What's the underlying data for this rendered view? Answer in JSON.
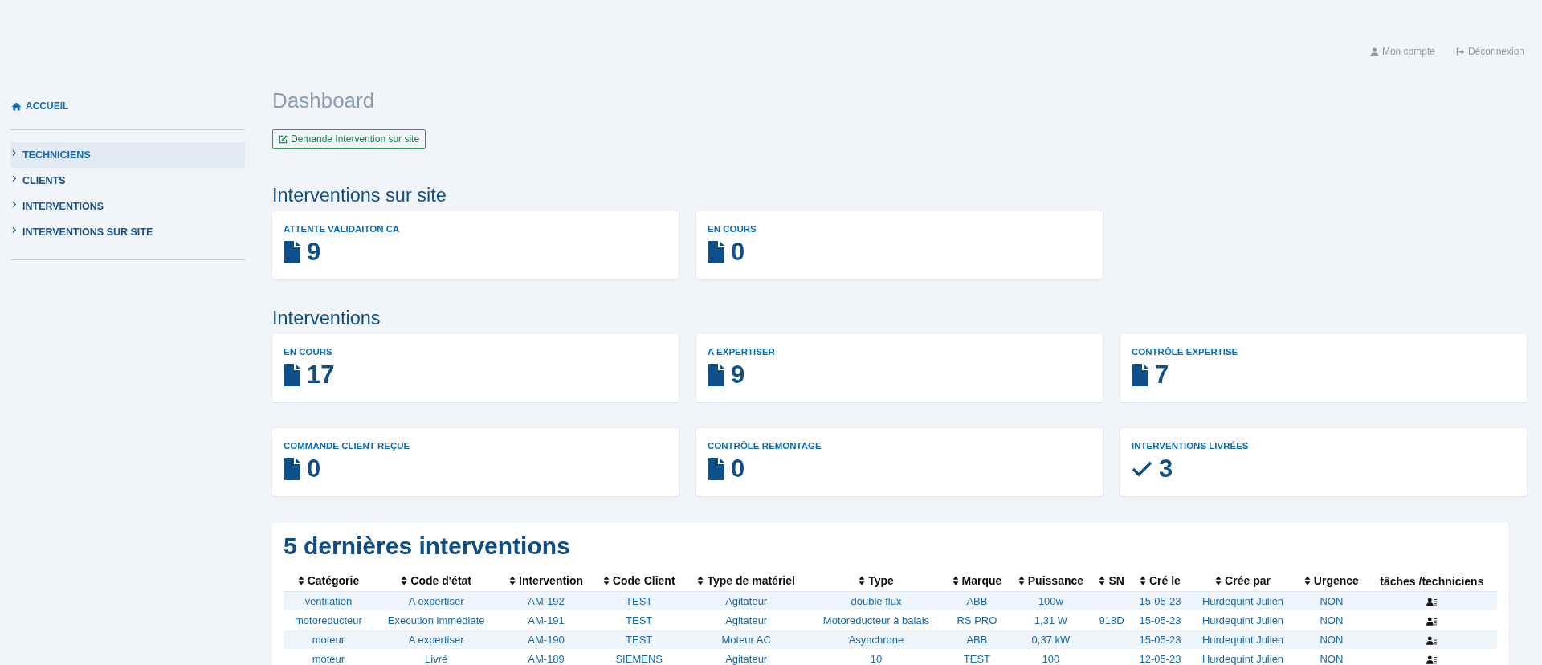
{
  "top_links": [
    {
      "kind": "user",
      "label": "Mon compte"
    },
    {
      "kind": "logout",
      "label": "Déconnexion"
    }
  ],
  "sidebar": {
    "home": "ACCUEIL",
    "items": [
      {
        "label": "TECHNICIENS",
        "selected": true
      },
      {
        "label": "CLIENTS",
        "selected": false
      },
      {
        "label": "INTERVENTIONS",
        "selected": false
      },
      {
        "label": "INTERVENTIONS SUR SITE",
        "selected": false
      }
    ]
  },
  "page_title": "Dashboard",
  "action_button": "Demande Intervention sur site",
  "sections": [
    {
      "title": "Interventions sur site",
      "rows": [
        [
          {
            "label": "ATTENTE VALIDAITON CA",
            "value": "9",
            "kind": "document"
          },
          {
            "label": "EN COURS",
            "value": "0",
            "kind": "document"
          }
        ]
      ]
    },
    {
      "title": "Interventions",
      "rows": [
        [
          {
            "label": "EN COURS",
            "value": "17",
            "kind": "document"
          },
          {
            "label": "A EXPERTISER",
            "value": "9",
            "kind": "document"
          },
          {
            "label": "CONTRÔLE EXPERTISE",
            "value": "7",
            "kind": "document"
          }
        ],
        [
          {
            "label": "COMMANDE CLIENT REÇUE",
            "value": "0",
            "kind": "document"
          },
          {
            "label": "CONTRÔLE REMONTAGE",
            "value": "0",
            "kind": "document"
          },
          {
            "label": "INTERVENTIONS LIVRÉES",
            "value": "3",
            "kind": "done"
          }
        ]
      ]
    }
  ],
  "table": {
    "title": "5 dernières interventions",
    "columns": [
      {
        "label": "Catégorie",
        "sortable": true
      },
      {
        "label": "Code d'état",
        "sortable": true
      },
      {
        "label": "Intervention",
        "sortable": true
      },
      {
        "label": "Code Client",
        "sortable": true
      },
      {
        "label": "Type de matériel",
        "sortable": true
      },
      {
        "label": "Type",
        "sortable": true
      },
      {
        "label": "Marque",
        "sortable": true
      },
      {
        "label": "Puissance",
        "sortable": true
      },
      {
        "label": "SN",
        "sortable": true
      },
      {
        "label": "Cré le",
        "sortable": true
      },
      {
        "label": "Crée par",
        "sortable": true
      },
      {
        "label": "Urgence",
        "sortable": true
      },
      {
        "label": "tâches /techniciens",
        "sortable": false
      }
    ],
    "rows": [
      [
        "ventilation",
        "A expertiser",
        "AM-192",
        "TEST",
        "Agitateur",
        "double flux",
        "ABB",
        "100w",
        "",
        "15-05-23",
        "Hurdequint Julien",
        "NON"
      ],
      [
        "motoreducteur",
        "Execution immédiate",
        "AM-191",
        "TEST",
        "Agitateur",
        "Motoreducteur à balais",
        "RS PRO",
        "1,31 W",
        "918D",
        "15-05-23",
        "Hurdequint Julien",
        "NON"
      ],
      [
        "moteur",
        "A expertiser",
        "AM-190",
        "TEST",
        "Moteur AC",
        "Asynchrone",
        "ABB",
        "0,37 kW",
        "",
        "15-05-23",
        "Hurdequint Julien",
        "NON"
      ],
      [
        "moteur",
        "Livré",
        "AM-189",
        "SIEMENS",
        "Agitateur",
        "10",
        "TEST",
        "100",
        "",
        "12-05-23",
        "Hurdequint Julien",
        "NON"
      ]
    ]
  }
}
